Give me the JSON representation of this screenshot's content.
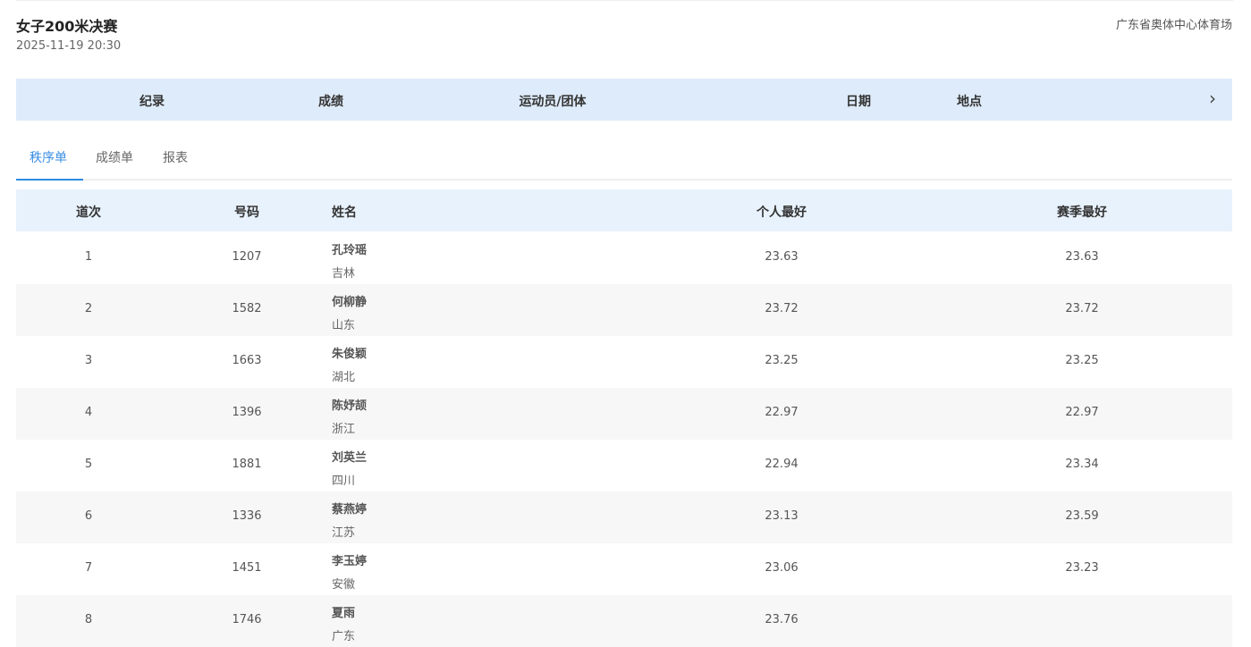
{
  "event": {
    "title": "女子200米决赛",
    "datetime": "2025-11-19 20:30",
    "venue": "广东省奥体中心体育场"
  },
  "record_bar": {
    "columns": [
      "纪录",
      "成绩",
      "运动员/团体",
      "日期",
      "地点"
    ]
  },
  "tabs": [
    "秩序单",
    "成绩单",
    "报表"
  ],
  "table": {
    "headers": [
      "道次",
      "号码",
      "姓名",
      "个人最好",
      "赛季最好"
    ],
    "rows": [
      {
        "lane": "1",
        "bib": "1207",
        "name": "孔玲瑶",
        "province": "吉林",
        "pb": "23.63",
        "sb": "23.63"
      },
      {
        "lane": "2",
        "bib": "1582",
        "name": "何柳静",
        "province": "山东",
        "pb": "23.72",
        "sb": "23.72"
      },
      {
        "lane": "3",
        "bib": "1663",
        "name": "朱俊颖",
        "province": "湖北",
        "pb": "23.25",
        "sb": "23.25"
      },
      {
        "lane": "4",
        "bib": "1396",
        "name": "陈妤颉",
        "province": "浙江",
        "pb": "22.97",
        "sb": "22.97"
      },
      {
        "lane": "5",
        "bib": "1881",
        "name": "刘英兰",
        "province": "四川",
        "pb": "22.94",
        "sb": "23.34"
      },
      {
        "lane": "6",
        "bib": "1336",
        "name": "蔡燕婷",
        "province": "江苏",
        "pb": "23.13",
        "sb": "23.59"
      },
      {
        "lane": "7",
        "bib": "1451",
        "name": "李玉婷",
        "province": "安徽",
        "pb": "23.06",
        "sb": "23.23"
      },
      {
        "lane": "8",
        "bib": "1746",
        "name": "夏雨",
        "province": "广东",
        "pb": "23.76"
      }
    ]
  }
}
